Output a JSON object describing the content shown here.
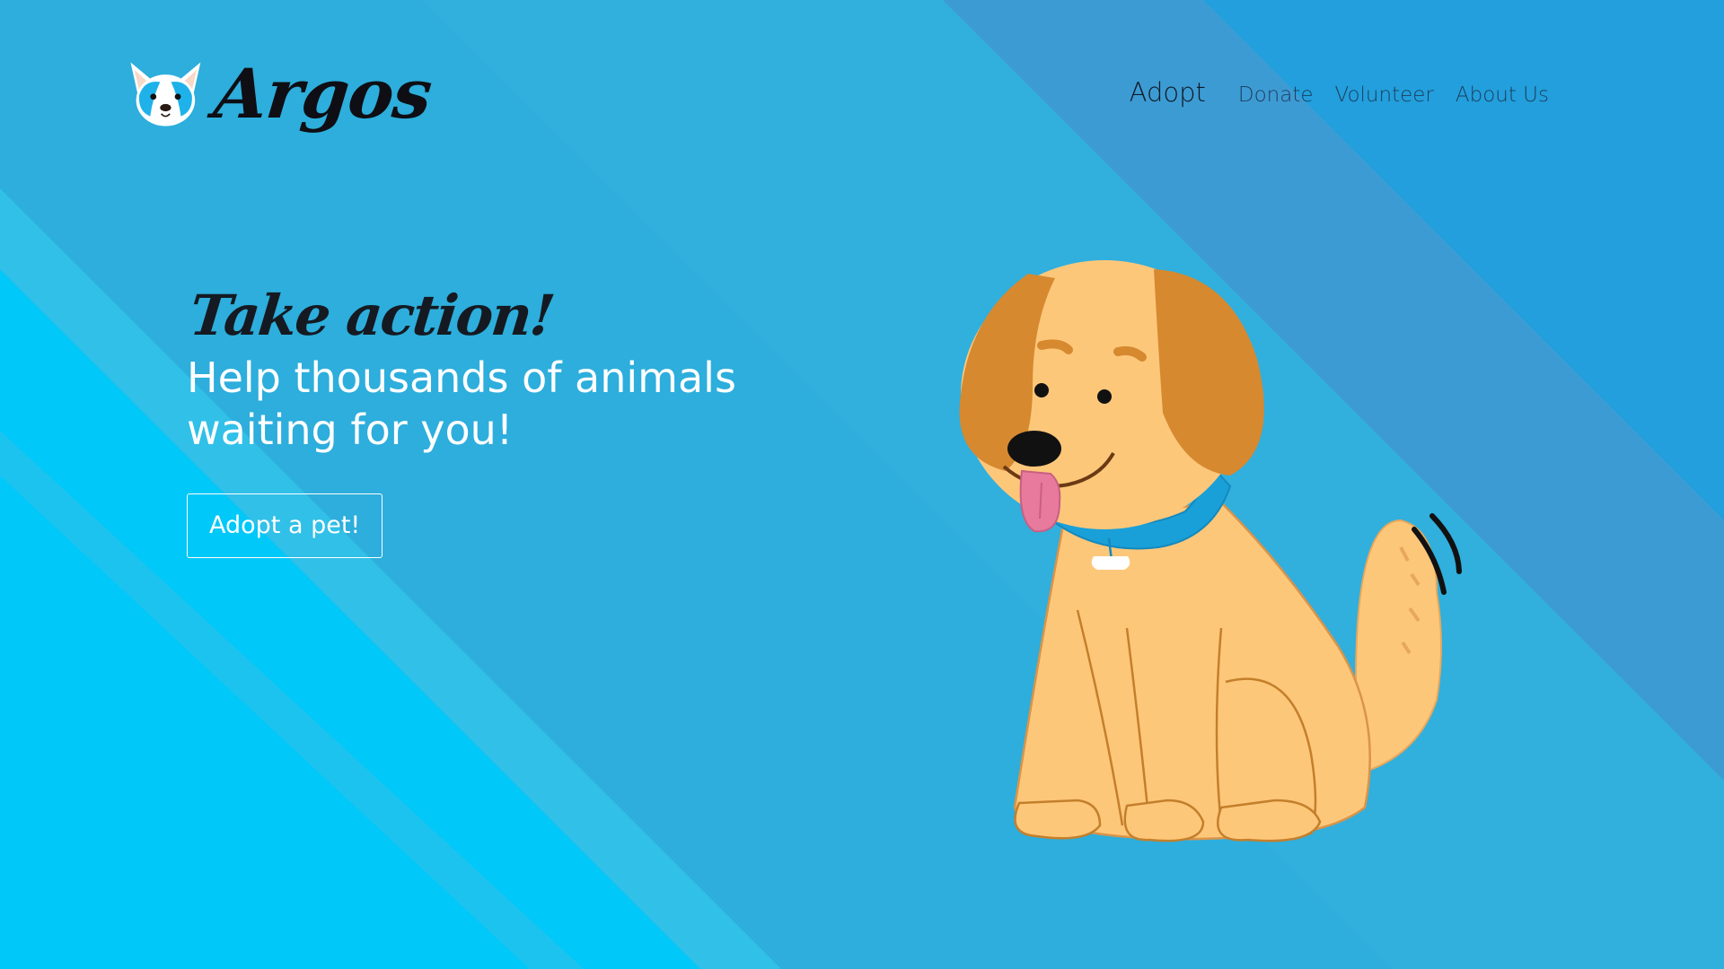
{
  "brand": {
    "name": "Argos",
    "logo_icon": "dog-face-icon"
  },
  "nav": {
    "items": [
      {
        "label": "Adopt",
        "active": true
      },
      {
        "label": "Donate",
        "active": false
      },
      {
        "label": "Volunteer",
        "active": false
      },
      {
        "label": "About Us",
        "active": false
      }
    ]
  },
  "hero": {
    "eyebrow": "Take action!",
    "title": "Help thousands of animals waiting for you!",
    "cta_label": "Adopt a pet!",
    "illustration": "puppy-illustration"
  },
  "colors": {
    "bg_primary": "#2eaedc",
    "bg_bright": "#00c8f8",
    "bg_stripe": "#3a9ed6",
    "text_dark": "#151a22",
    "text_light": "#ffffff",
    "dog_fur": "#fdc77a",
    "dog_ear": "#d6892f",
    "collar": "#1aa0d8"
  }
}
